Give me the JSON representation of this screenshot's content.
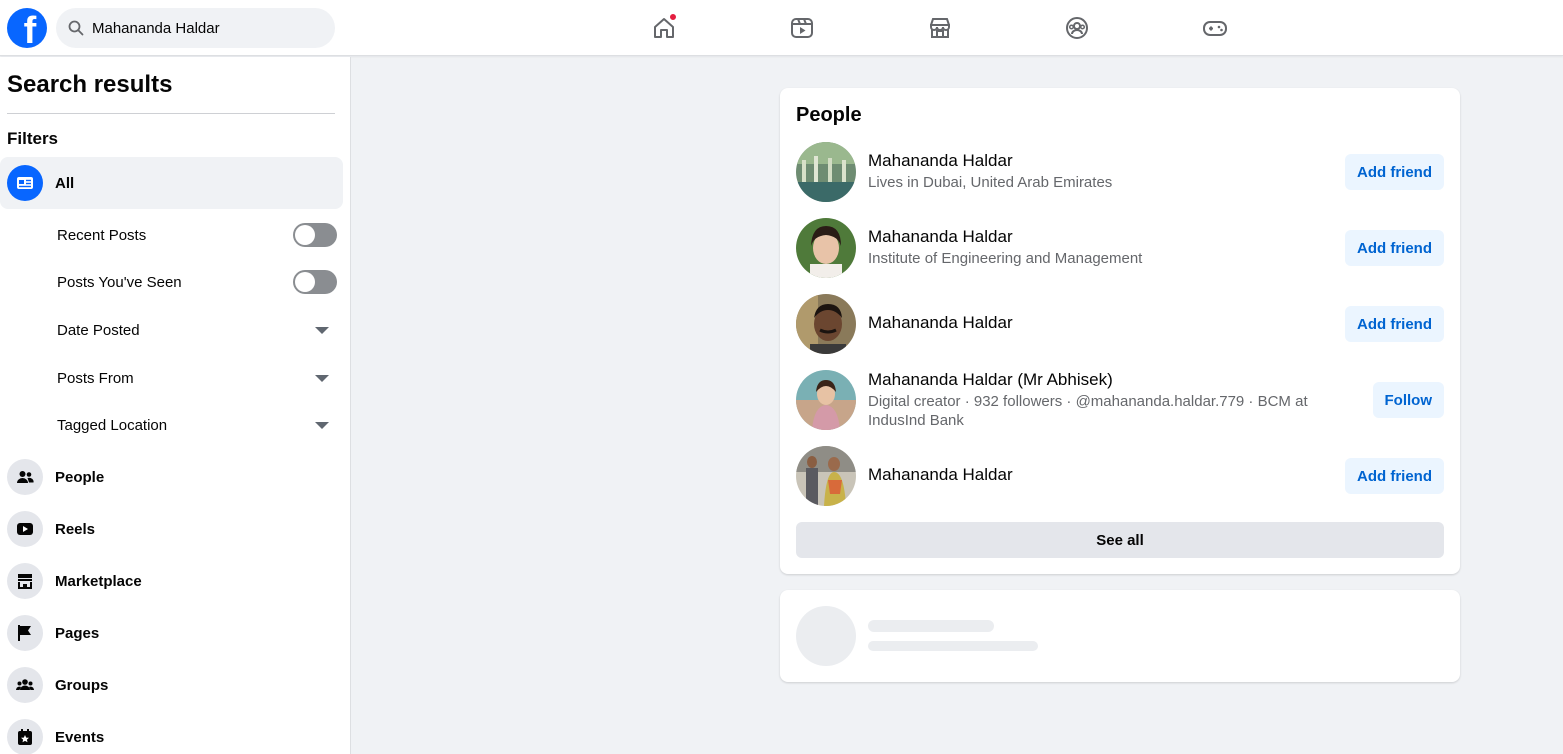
{
  "search": {
    "value": "Mahananda Haldar"
  },
  "nav": [
    {
      "name": "home-icon",
      "has_notification": true
    },
    {
      "name": "video-icon"
    },
    {
      "name": "marketplace-icon"
    },
    {
      "name": "groups-icon"
    },
    {
      "name": "gaming-icon"
    }
  ],
  "sidebar": {
    "title": "Search results",
    "filters_heading": "Filters",
    "all_label": "All",
    "sub_filters": [
      {
        "label": "Recent Posts",
        "control": "toggle",
        "on": false
      },
      {
        "label": "Posts You've Seen",
        "control": "toggle",
        "on": false
      },
      {
        "label": "Date Posted",
        "control": "dropdown"
      },
      {
        "label": "Posts From",
        "control": "dropdown"
      },
      {
        "label": "Tagged Location",
        "control": "dropdown"
      }
    ],
    "categories": [
      {
        "label": "People",
        "icon": "people-icon"
      },
      {
        "label": "Reels",
        "icon": "reels-icon"
      },
      {
        "label": "Marketplace",
        "icon": "marketplace-icon"
      },
      {
        "label": "Pages",
        "icon": "flag-icon"
      },
      {
        "label": "Groups",
        "icon": "groups-icon"
      },
      {
        "label": "Events",
        "icon": "calendar-icon"
      }
    ]
  },
  "people": {
    "title": "People",
    "results": [
      {
        "name": "Mahananda Haldar",
        "subtitle": "Lives in Dubai, United Arab Emirates",
        "action": "Add friend"
      },
      {
        "name": "Mahananda Haldar",
        "subtitle": "Institute of Engineering and Management",
        "action": "Add friend"
      },
      {
        "name": "Mahananda Haldar",
        "subtitle": "",
        "action": "Add friend"
      },
      {
        "name": "Mahananda Haldar (Mr Abhisek)",
        "subtitle": "Digital creator · 932 followers · @mahananda.haldar.779 · BCM at IndusInd Bank",
        "action": "Follow"
      },
      {
        "name": "Mahananda Haldar",
        "subtitle": "",
        "action": "Add friend"
      }
    ],
    "see_all": "See all"
  },
  "colors": {
    "brand": "#0866ff",
    "button_text": "#0064d1",
    "button_bg": "#ebf5ff",
    "notification": "#e41e3f"
  }
}
